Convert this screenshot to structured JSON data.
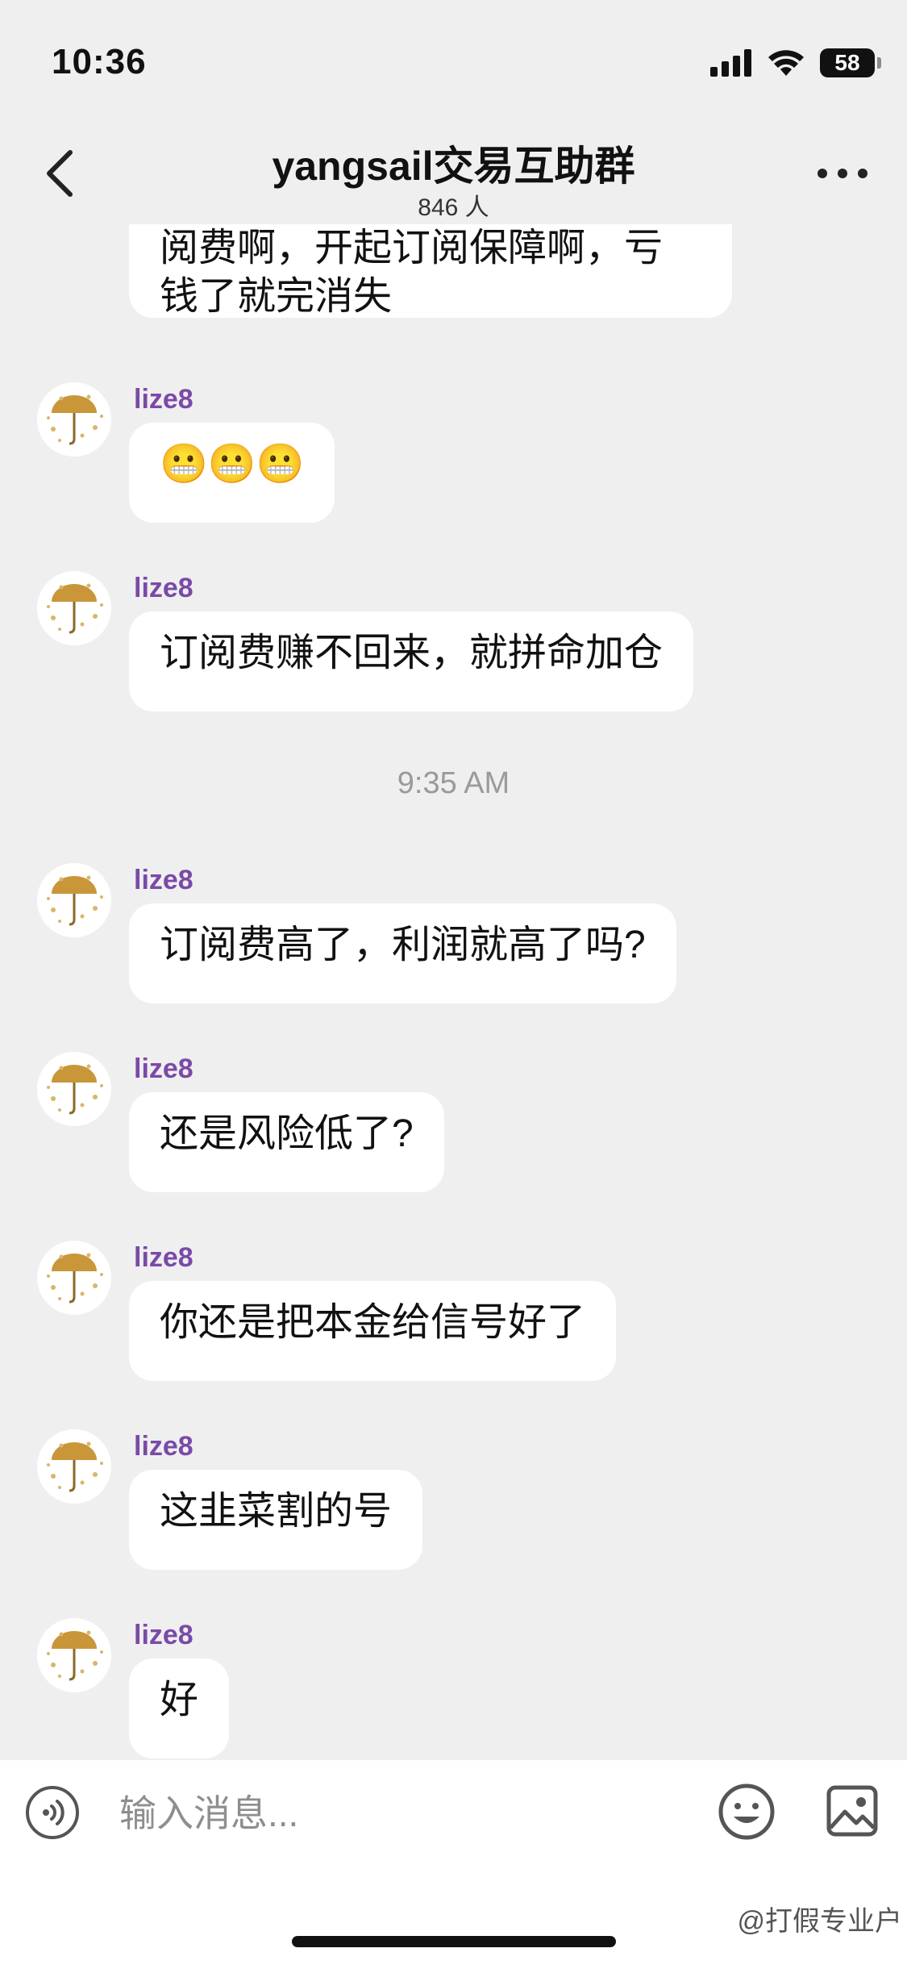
{
  "status_bar": {
    "time": "10:36",
    "battery": "58"
  },
  "header": {
    "title": "yangsail交易互助群",
    "member_count": "846 人"
  },
  "messages": [
    {
      "text_line1": "阅费啊，开起订阅保障啊，亏",
      "text_line2": "钱了就完消失"
    },
    {
      "sender": "lize8",
      "text": "😬😬😬"
    },
    {
      "sender": "lize8",
      "text": "订阅费赚不回来，就拼命加仓"
    },
    {
      "sender": "lize8",
      "text": "订阅费高了，利润就高了吗?"
    },
    {
      "sender": "lize8",
      "text": "还是风险低了?"
    },
    {
      "sender": "lize8",
      "text": "你还是把本金给信号好了"
    },
    {
      "sender": "lize8",
      "text": "这韭菜割的号"
    },
    {
      "sender": "lize8",
      "text": "好"
    }
  ],
  "time_separator": "9:35 AM",
  "input": {
    "placeholder": "输入消息..."
  },
  "watermark": "@打假专业户",
  "colors": {
    "background": "#efeff0",
    "sender_name": "#7a4aa7",
    "bubble": "#ffffff"
  }
}
